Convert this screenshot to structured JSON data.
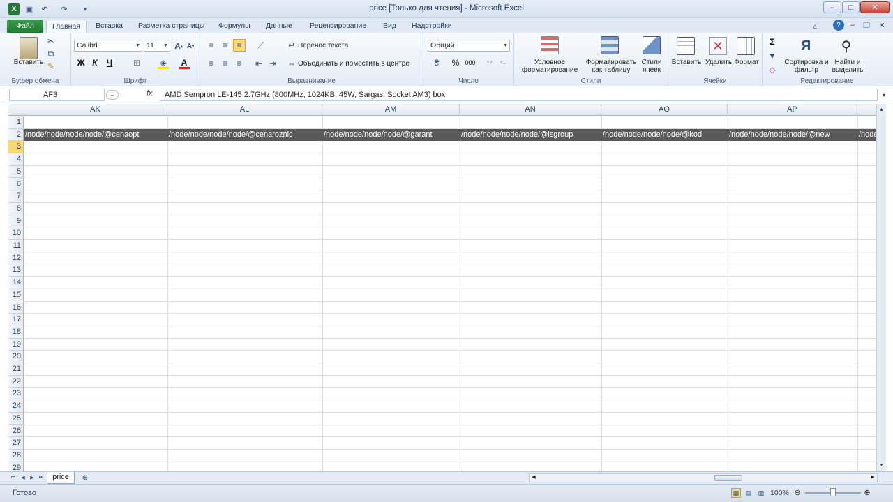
{
  "window": {
    "title": "price  [Только для чтения]  -  Microsoft Excel"
  },
  "tabs": [
    "Файл",
    "Главная",
    "Вставка",
    "Разметка страницы",
    "Формулы",
    "Данные",
    "Рецензирование",
    "Вид",
    "Надстройки"
  ],
  "ribbon": {
    "clipboard": {
      "paste": "Вставить",
      "label": "Буфер обмена"
    },
    "font": {
      "name": "Calibri",
      "size": "11",
      "bold": "Ж",
      "italic": "К",
      "underline": "Ч",
      "label": "Шрифт"
    },
    "alignment": {
      "wrap": "Перенос текста",
      "merge": "Объединить и поместить в центре",
      "label": "Выравнивание"
    },
    "number": {
      "format": "Общий",
      "percent": "%",
      "thousands": "000",
      "label": "Число"
    },
    "styles": {
      "conditional": "Условное форматирование",
      "astable": "Форматировать как таблицу",
      "cellstyles": "Стили ячеек",
      "label": "Стили"
    },
    "cells": {
      "insert": "Вставить",
      "delete": "Удалить",
      "format": "Формат",
      "label": "Ячейки"
    },
    "editing": {
      "sigma": "Σ",
      "sort": "Сортировка и фильтр",
      "find": "Найти и выделить",
      "label": "Редактирование"
    }
  },
  "formula_bar": {
    "name_box": "AF3",
    "fx": "fx",
    "content": "AMD Sempron LE-145 2.7GHz (800MHz, 1024KB, 45W, Sargas, Socket AM3) box"
  },
  "columns": [
    "AK",
    "AL",
    "AM",
    "AN",
    "AO",
    "AP"
  ],
  "row2_cells": [
    "/node/node/node/node/@cenaopt",
    "/node/node/node/node/@cenaroznic",
    "/node/node/node/node/@garant",
    "/node/node/node/node/@isgroup",
    "/node/node/node/node/@kod",
    "/node/node/node/node/@new",
    "/node"
  ],
  "rows": [
    "1",
    "2",
    "3",
    "4",
    "5",
    "6",
    "7",
    "8",
    "9",
    "10",
    "11",
    "12",
    "13",
    "14",
    "15",
    "16",
    "17",
    "18",
    "19",
    "20",
    "21",
    "22",
    "23",
    "24",
    "25",
    "26",
    "27",
    "28",
    "29"
  ],
  "selected_row": "3",
  "sheet_tab": "price",
  "status": {
    "ready": "Готово",
    "zoom": "100%"
  },
  "colors": {
    "header_fill": "#595959",
    "file_tab": "#2a8a3e",
    "selected_row": "#f9d677"
  }
}
